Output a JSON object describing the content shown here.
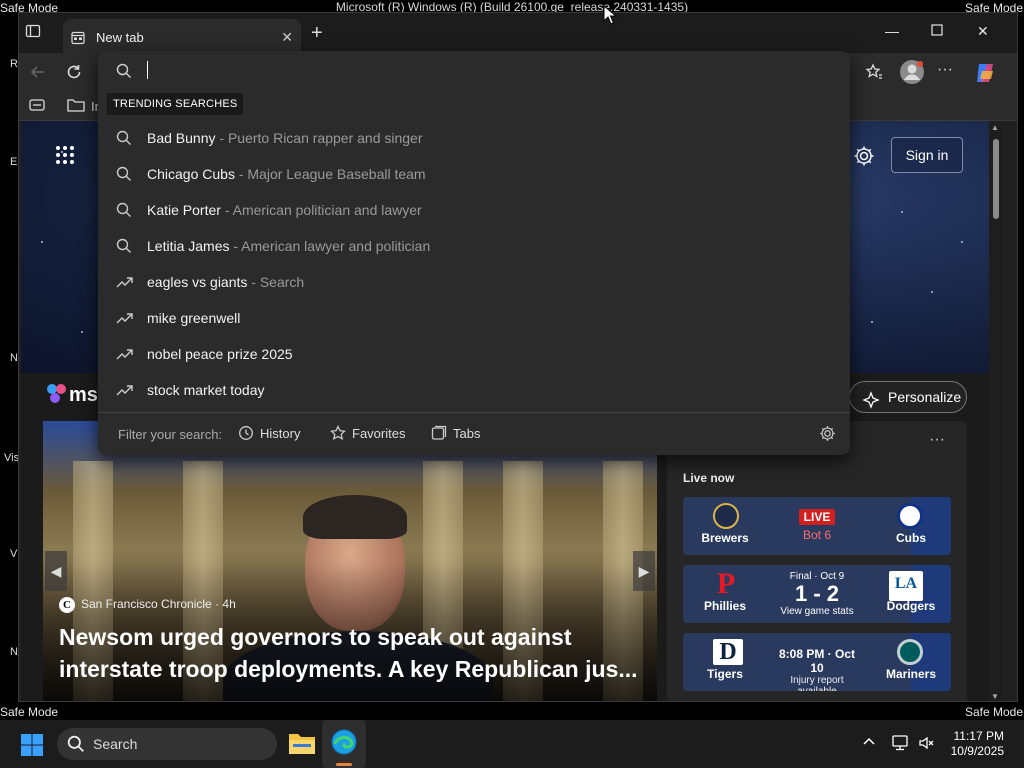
{
  "system": {
    "safe_mode_label": "Safe Mode",
    "os_title": "Microsoft (R) Windows (R) (Build 26100.ge_release.240331-1435)"
  },
  "desktop_fragments": [
    "Re",
    "E",
    "N",
    "Vis",
    "V",
    "N"
  ],
  "browser": {
    "tab_title": "New tab",
    "favbar_item_fragment": "Ir"
  },
  "msn": {
    "signin_label": "Sign in",
    "logo_text": "ms",
    "personalize_label": "Personalize",
    "feature": {
      "source": "San Francisco Chronicle",
      "age": "4h",
      "headline": "Newsom urged governors to speak out against interstate troop deployments. A key Republican jus..."
    },
    "live_now_label": "Live now",
    "games": [
      {
        "left_team": "Brewers",
        "right_team": "Cubs",
        "status": "LIVE",
        "detail": "Bot 6",
        "left_color": "#1e2a4a",
        "right_color": "#0e3386"
      },
      {
        "left_team": "Phillies",
        "right_team": "Dodgers",
        "status": "Final · Oct 9",
        "score": "1 - 2",
        "detail": "View game stats",
        "left_color": "#e81828",
        "right_color": "#005a9c"
      },
      {
        "left_team": "Tigers",
        "right_team": "Mariners",
        "status": "8:08 PM · Oct 10",
        "detail": "Injury report available",
        "left_color": "#0c2340",
        "right_color": "#005c5c"
      }
    ]
  },
  "dropdown": {
    "trending_label": "TRENDING SEARCHES",
    "suggestions": [
      {
        "icon": "search-icon",
        "main": "Bad Bunny",
        "sub": " - Puerto Rican rapper and singer"
      },
      {
        "icon": "search-icon",
        "main": "Chicago Cubs",
        "sub": " - Major League Baseball team"
      },
      {
        "icon": "search-icon",
        "main": "Katie Porter",
        "sub": " - American politician and lawyer"
      },
      {
        "icon": "search-icon",
        "main": "Letitia James",
        "sub": " - American lawyer and politician"
      },
      {
        "icon": "trending-icon",
        "main": "eagles vs giants",
        "sub": " - Search"
      },
      {
        "icon": "trending-icon",
        "main": "mike greenwell",
        "sub": ""
      },
      {
        "icon": "trending-icon",
        "main": "nobel peace prize 2025",
        "sub": ""
      },
      {
        "icon": "trending-icon",
        "main": "stock market today",
        "sub": ""
      }
    ],
    "filter_label": "Filter your search:",
    "filter_history": "History",
    "filter_favorites": "Favorites",
    "filter_tabs": "Tabs"
  },
  "taskbar": {
    "search_placeholder": "Search",
    "time": "11:17 PM",
    "date": "10/9/2025"
  }
}
